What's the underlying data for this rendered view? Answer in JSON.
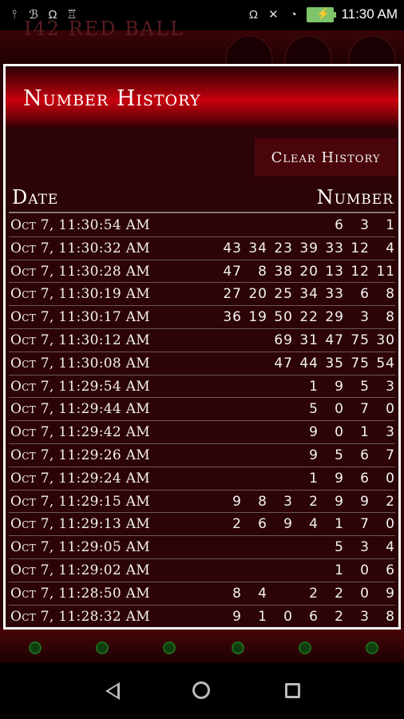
{
  "status_bar": {
    "left_icons": [
      "usb-icon",
      "notification-icon",
      "headset-icon",
      "android-icon"
    ],
    "right_icons": [
      "headset-icon",
      "mute-icon",
      "wifi-icon",
      "battery-charging-icon"
    ],
    "time": "11:30 AM"
  },
  "background_app": {
    "title": "I42 RED BALL"
  },
  "dialog": {
    "title": "Number History",
    "clear_button": "Clear History",
    "columns": {
      "date": "Date",
      "number": "Number"
    },
    "rows": [
      {
        "date": "Oct 7, 11:30:54 AM",
        "numbers": [
          "6",
          "3",
          "1"
        ]
      },
      {
        "date": "Oct 7, 11:30:32 AM",
        "numbers": [
          "43",
          "34",
          "23",
          "39",
          "33",
          "12",
          "4"
        ]
      },
      {
        "date": "Oct 7, 11:30:28 AM",
        "numbers": [
          "47",
          "8",
          "38",
          "20",
          "13",
          "12",
          "11"
        ]
      },
      {
        "date": "Oct 7, 11:30:19 AM",
        "numbers": [
          "27",
          "20",
          "25",
          "34",
          "33",
          "6",
          "8"
        ]
      },
      {
        "date": "Oct 7, 11:30:17 AM",
        "numbers": [
          "36",
          "19",
          "50",
          "22",
          "29",
          "3",
          "8"
        ]
      },
      {
        "date": "Oct 7, 11:30:12 AM",
        "numbers": [
          "69",
          "31",
          "47",
          "75",
          "30"
        ]
      },
      {
        "date": "Oct 7, 11:30:08 AM",
        "numbers": [
          "47",
          "44",
          "35",
          "75",
          "54"
        ]
      },
      {
        "date": "Oct 7, 11:29:54 AM",
        "numbers": [
          "1",
          "9",
          "5",
          "3"
        ]
      },
      {
        "date": "Oct 7, 11:29:44 AM",
        "numbers": [
          "5",
          "0",
          "7",
          "0"
        ]
      },
      {
        "date": "Oct 7, 11:29:42 AM",
        "numbers": [
          "9",
          "0",
          "1",
          "3"
        ]
      },
      {
        "date": "Oct 7, 11:29:26 AM",
        "numbers": [
          "9",
          "5",
          "6",
          "7"
        ]
      },
      {
        "date": "Oct 7, 11:29:24 AM",
        "numbers": [
          "1",
          "9",
          "6",
          "0"
        ]
      },
      {
        "date": "Oct 7, 11:29:15 AM",
        "numbers": [
          "9",
          "8",
          "3",
          "2",
          "9",
          "9",
          "2"
        ]
      },
      {
        "date": "Oct 7, 11:29:13 AM",
        "numbers": [
          "2",
          "6",
          "9",
          "4",
          "1",
          "7",
          "0"
        ]
      },
      {
        "date": "Oct 7, 11:29:05 AM",
        "numbers": [
          "5",
          "3",
          "4"
        ]
      },
      {
        "date": "Oct 7, 11:29:02 AM",
        "numbers": [
          "1",
          "0",
          "6"
        ]
      },
      {
        "date": "Oct 7, 11:28:50 AM",
        "numbers": [
          "8",
          "4",
          "",
          "2",
          "2",
          "0",
          "9"
        ]
      },
      {
        "date": "Oct 7, 11:28:32 AM",
        "numbers": [
          "9",
          "1",
          "0",
          "6",
          "2",
          "3",
          "8"
        ]
      }
    ]
  },
  "navigation": {
    "icons": [
      "back-icon",
      "home-icon",
      "recent-apps-icon"
    ]
  },
  "colors": {
    "header_red": "#c9000e",
    "panel_bg": "#2c0306",
    "text": "#f2f2f2",
    "battery": "#7ec46a"
  }
}
